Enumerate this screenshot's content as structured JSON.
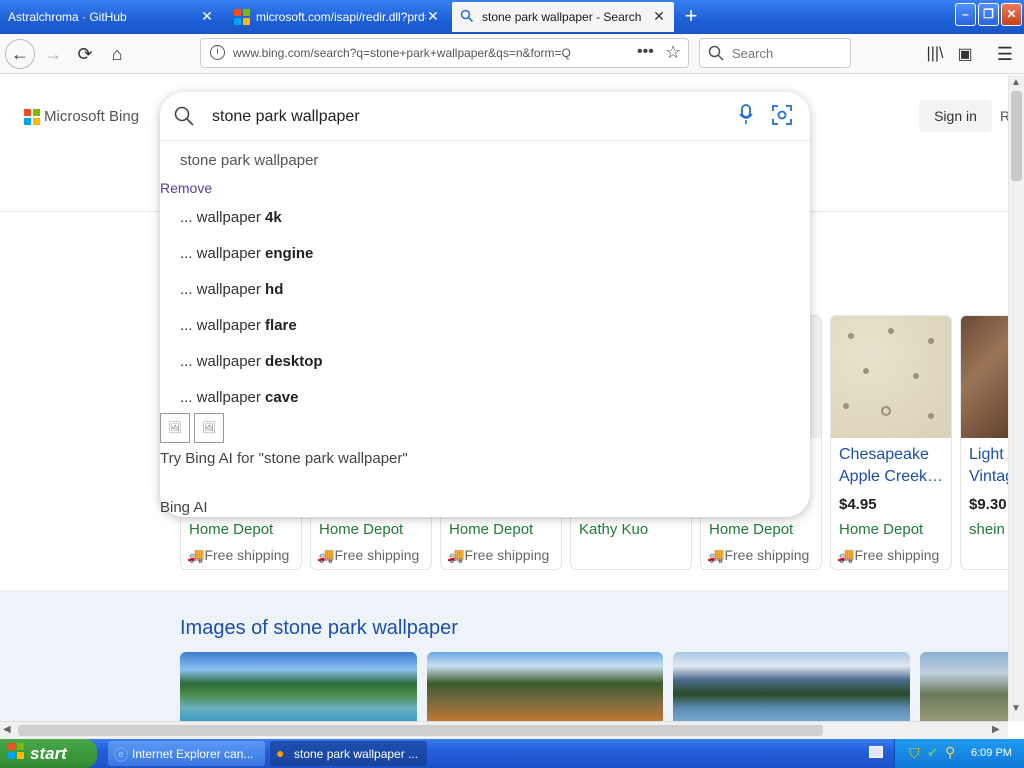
{
  "tabs": [
    {
      "title": "Astralchroma · GitHub"
    },
    {
      "title": "microsoft.com/isapi/redir.dll?prd="
    },
    {
      "title": "stone park wallpaper - Search"
    }
  ],
  "nav": {
    "url": "www.bing.com/search?q=stone+park+wallpaper&qs=n&form=Q",
    "search_placeholder": "Search"
  },
  "bing": {
    "logo_text": "Microsoft Bing",
    "query": "stone park wallpaper",
    "sign_in": "Sign in",
    "cut_letter": "R"
  },
  "suggestions": {
    "history_item": "stone park wallpaper",
    "remove_label": "Remove",
    "items": [
      {
        "prefix": "... wallpaper ",
        "bold": "4k"
      },
      {
        "prefix": "... wallpaper ",
        "bold": "engine"
      },
      {
        "prefix": "... wallpaper ",
        "bold": "hd"
      },
      {
        "prefix": "... wallpaper ",
        "bold": "flare"
      },
      {
        "prefix": "... wallpaper ",
        "bold": "desktop"
      },
      {
        "prefix": "... wallpaper ",
        "bold": "cave"
      }
    ],
    "try_ai": "Try Bing AI for \"stone park wallpaper\"",
    "bing_ai": "Bing AI"
  },
  "products": [
    {
      "store": "Home Depot",
      "ship": "Free shipping"
    },
    {
      "store": "Home Depot",
      "ship": "Free shipping"
    },
    {
      "store": "Home Depot",
      "ship": "Free shipping"
    },
    {
      "store": "Kathy Kuo",
      "ship": ""
    },
    {
      "store": "Home Depot",
      "ship": "Free shipping"
    },
    {
      "title": "Chesapeake Apple Creek…",
      "price": "$4.95",
      "store": "Home Depot",
      "ship": "Free shipping"
    },
    {
      "title": "Light Vintag",
      "price": "$9.30",
      "store": "shein",
      "ship": ""
    }
  ],
  "images_heading": "Images of stone park wallpaper",
  "taskbar": {
    "start": "start",
    "items": [
      {
        "label": "Internet Explorer can..."
      },
      {
        "label": "stone park wallpaper ..."
      }
    ],
    "clock": "6:09 PM"
  }
}
